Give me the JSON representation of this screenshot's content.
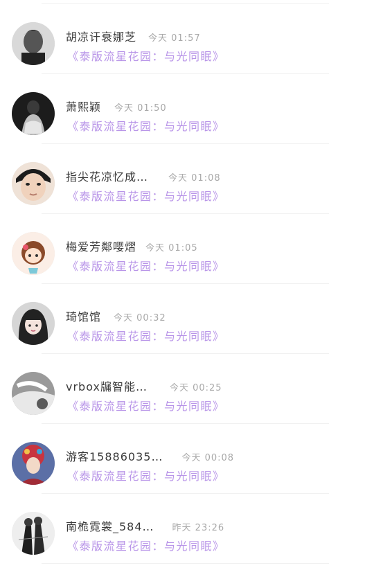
{
  "comments": [
    {
      "name": "胡凉讦衰娜芝",
      "time": "今天 01:57",
      "title": "《泰版流星花园：与光同眠》",
      "avatar_icon": "avatar-man-portrait"
    },
    {
      "name": "萧熙颖",
      "time": "今天 01:50",
      "title": "《泰版流星花园：与光同眠》",
      "avatar_icon": "avatar-girl-dark"
    },
    {
      "name": "指尖花凉忆成…",
      "time": "今天 01:08",
      "title": "《泰版流星花园：与光同眠》",
      "avatar_icon": "avatar-boy-close"
    },
    {
      "name": "梅爱芳鄰嘤熠",
      "time": "今天 01:05",
      "title": "《泰版流星花园：与光同眠》",
      "avatar_icon": "avatar-cartoon-girl"
    },
    {
      "name": "琦馆馆",
      "time": "今天 00:32",
      "title": "《泰版流星花园：与光同眠》",
      "avatar_icon": "avatar-girl-bangs"
    },
    {
      "name": "vrbox牖智能…",
      "time": "今天 00:25",
      "title": "《泰版流星花园：与光同眠》",
      "avatar_icon": "avatar-grayscale-photo"
    },
    {
      "name": "游客15886035…",
      "time": "今天 00:08",
      "title": "《泰版流星花园：与光同眠》",
      "avatar_icon": "avatar-opera-costume"
    },
    {
      "name": "南桅霓裳_584…",
      "time": "昨天 23:26",
      "title": "《泰版流星花园：与光同眠》",
      "avatar_icon": "avatar-illustration-couple"
    }
  ]
}
